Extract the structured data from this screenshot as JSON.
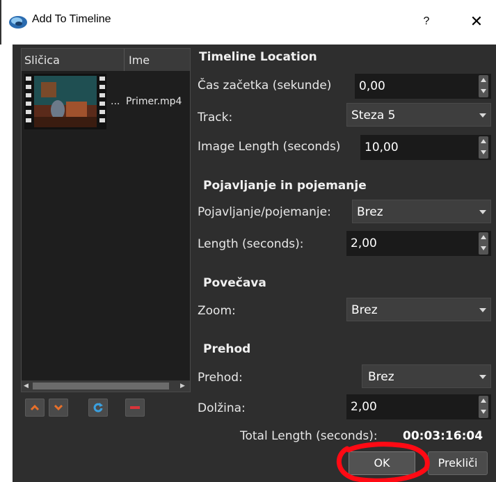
{
  "window": {
    "title": "Add To Timeline",
    "help_label": "?",
    "close_label": "✕"
  },
  "file_list": {
    "col_thumbnail": "Sličica",
    "col_name": "Ime",
    "items": [
      {
        "ellipsis": "...",
        "name": "Primer.mp4"
      }
    ],
    "scroll_left": "◀",
    "scroll_right": "▶"
  },
  "list_buttons": {
    "icons": [
      "chevron-up-icon",
      "chevron-down-icon",
      "refresh-icon",
      "remove-icon"
    ],
    "accent_orange": "#e8702a",
    "accent_blue": "#3aa0e0",
    "accent_red": "#d9343a"
  },
  "timeline_location": {
    "title": "Timeline Location",
    "start_label": "Čas začetka (sekunde)",
    "start_value": "0,00",
    "track_label": "Track:",
    "track_value": "Steza 5",
    "image_length_label": "Image Length (seconds)",
    "image_length_value": "10,00"
  },
  "fade": {
    "title": "Pojavljanje in pojemanje",
    "fade_label": "Pojavljanje/pojemanje:",
    "fade_value": "Brez",
    "length_label": "Length (seconds):",
    "length_value": "2,00"
  },
  "zoom": {
    "title": "Povečava",
    "zoom_label": "Zoom:",
    "zoom_value": "Brez"
  },
  "transition": {
    "title": "Prehod",
    "transition_label": "Prehod:",
    "transition_value": "Brez",
    "duration_label": "Dolžina:",
    "duration_value": "2,00"
  },
  "total": {
    "label": "Total Length (seconds):",
    "value": "00:03:16:04"
  },
  "buttons": {
    "ok": "OK",
    "cancel": "Prekliči"
  },
  "annotation_color": "#ff0a14"
}
